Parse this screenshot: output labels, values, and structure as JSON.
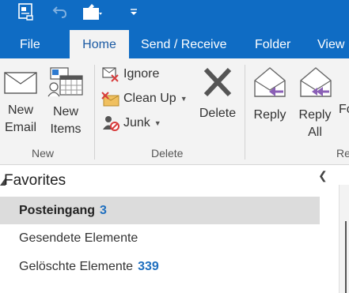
{
  "quick_access": {
    "icons": [
      "send-receive-icon",
      "undo-icon",
      "touch-mode-icon",
      "customize-icon"
    ]
  },
  "tabs": [
    {
      "label": "File"
    },
    {
      "label": "Home",
      "active": true
    },
    {
      "label": "Send / Receive"
    },
    {
      "label": "Folder"
    },
    {
      "label": "View"
    }
  ],
  "ribbon": {
    "new_group": {
      "label": "New",
      "new_email": {
        "line1": "New",
        "line2": "Email"
      },
      "new_items": {
        "line1": "New",
        "line2": "Items"
      }
    },
    "delete_group": {
      "label": "Delete",
      "ignore": "Ignore",
      "clean_up": "Clean Up",
      "junk": "Junk",
      "delete": "Delete"
    },
    "respond_group": {
      "label": "Re",
      "reply": "Reply",
      "reply_all": {
        "line1": "Reply",
        "line2": "All"
      },
      "forward_partial": "Fo"
    }
  },
  "favorites": {
    "heading": "Favorites",
    "folders": [
      {
        "name": "Posteingang",
        "count": "3",
        "selected": true
      },
      {
        "name": "Gesendete Elemente",
        "count": ""
      },
      {
        "name": "Gelöschte Elemente",
        "count": "339"
      }
    ]
  },
  "colors": {
    "titlebar": "#0f6cc4",
    "ribbon": "#f3f3f3",
    "count": "#1f6fbf",
    "reply_arrow": "#8a5fb6"
  }
}
